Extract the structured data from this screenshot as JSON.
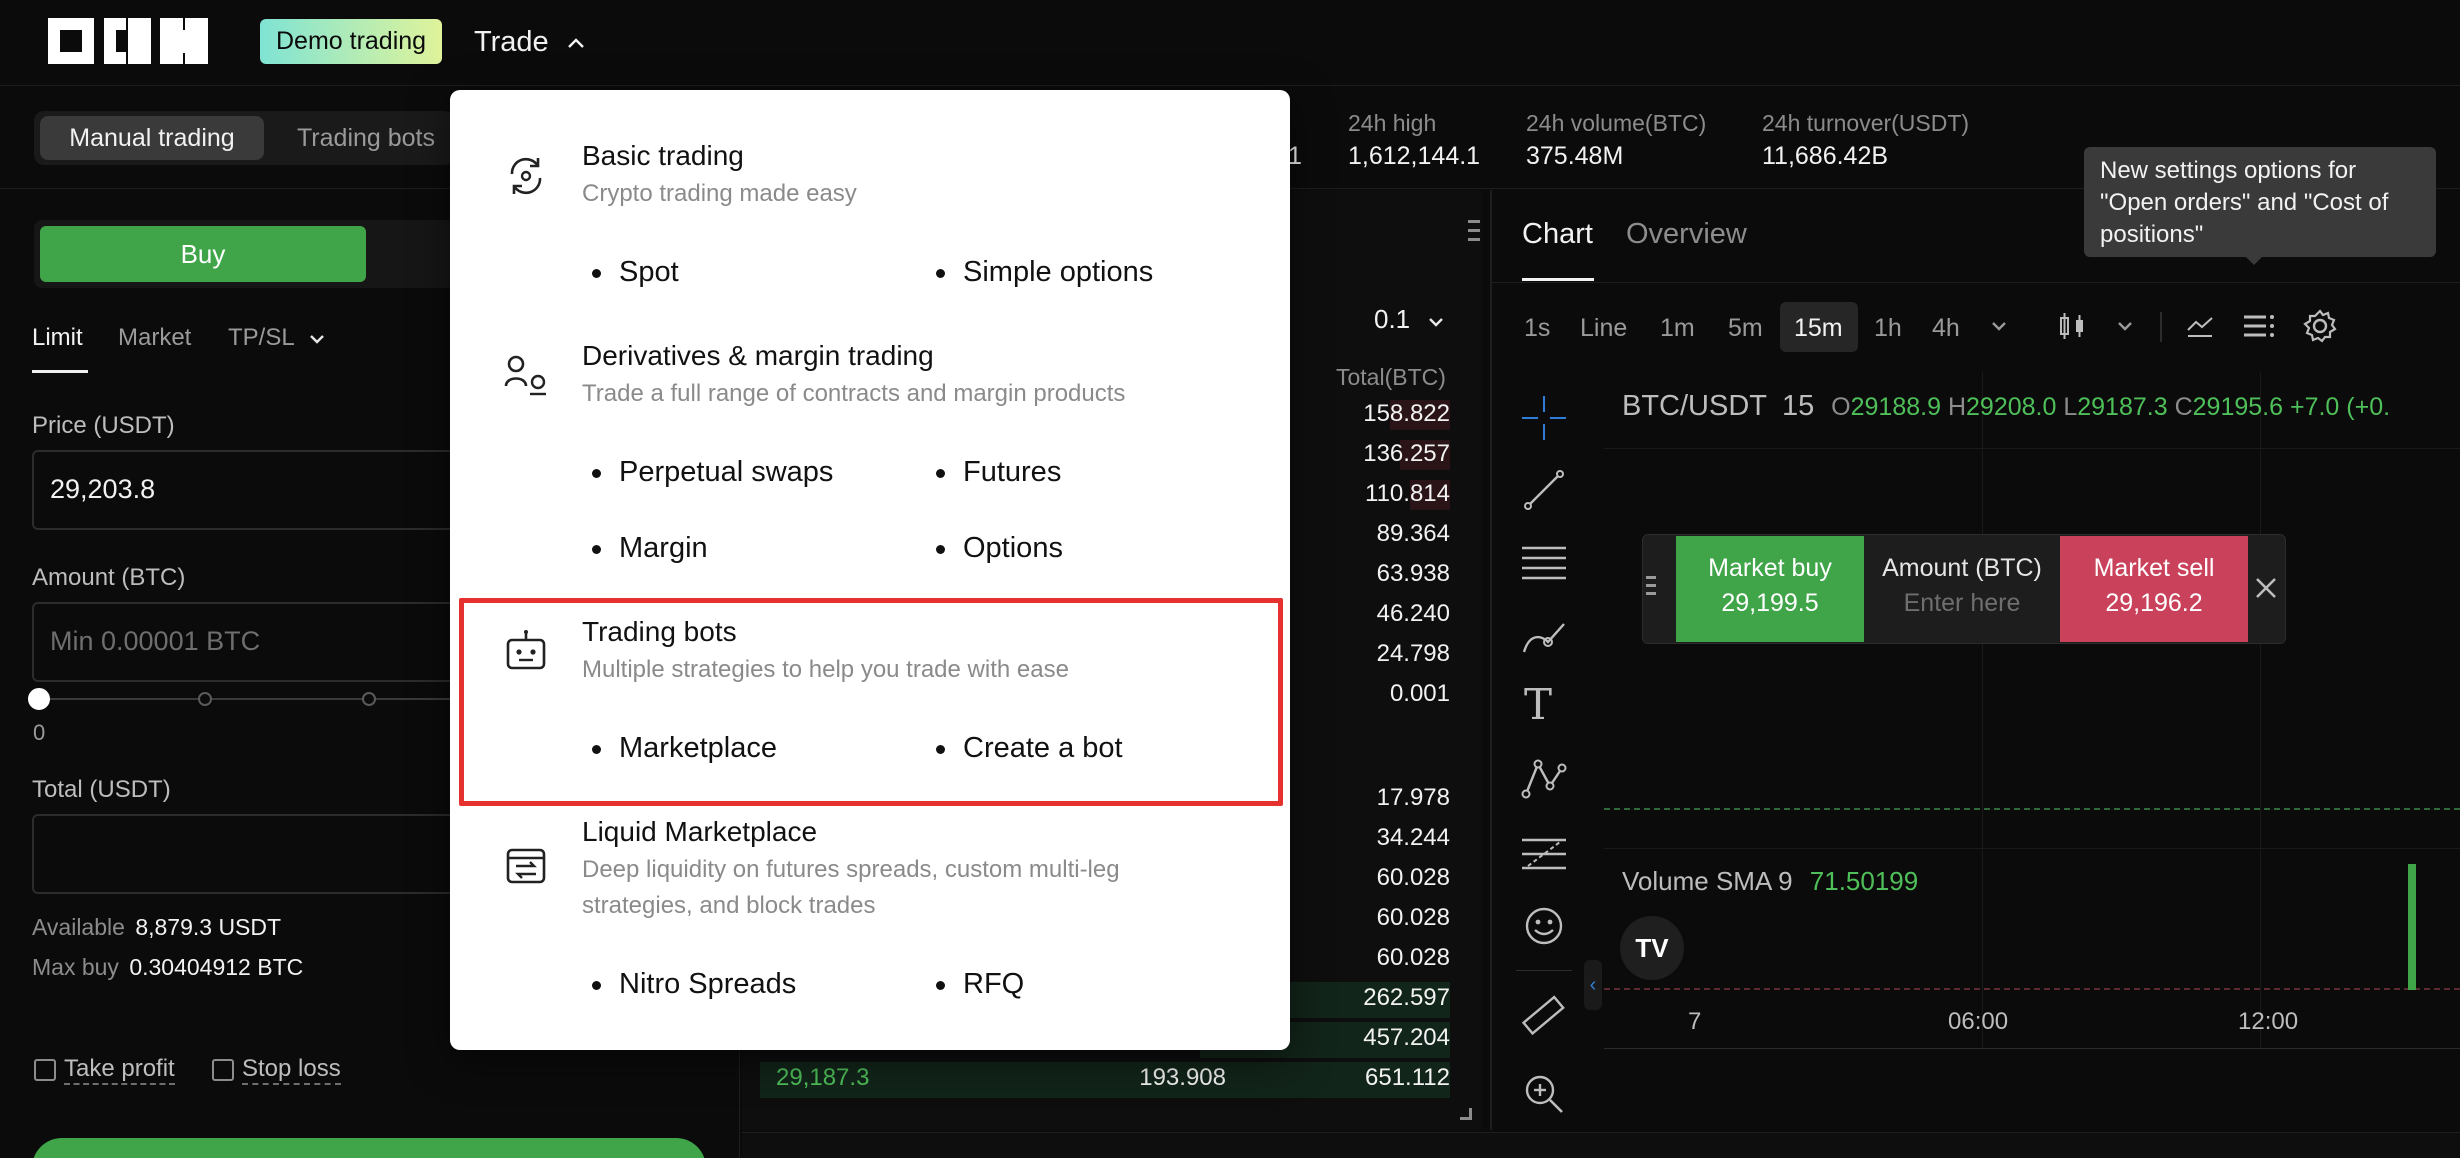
{
  "header": {
    "demo_badge": "Demo trading",
    "trade_menu": "Trade"
  },
  "subbar": {
    "tabs": [
      "Manual trading",
      "Trading bots"
    ],
    "stats_partial_value": "1",
    "stats": [
      {
        "label": "24h high",
        "value": "1,612,144.1"
      },
      {
        "label": "24h volume(BTC)",
        "value": "375.48M"
      },
      {
        "label": "24h turnover(USDT)",
        "value": "11,686.42B"
      }
    ]
  },
  "order_panel": {
    "buy_label": "Buy",
    "order_types": [
      "Limit",
      "Market",
      "TP/SL"
    ],
    "price_label": "Price (USDT)",
    "price_value": "29,203.8",
    "amount_label": "Amount (BTC)",
    "amount_placeholder": "Min 0.00001 BTC",
    "slider_value_label": "0",
    "slider_level": 0,
    "total_label": "Total (USDT)",
    "available_label": "Available",
    "available_value": "8,879.3 USDT",
    "max_buy_label": "Max buy",
    "max_buy_value": "0.30404912 BTC",
    "take_profit": "Take profit",
    "stop_loss": "Stop loss"
  },
  "order_book": {
    "precision": "0.1",
    "total_header": "Total(BTC)",
    "totals_top": [
      "158.822",
      "136.257",
      "110.814",
      "89.364",
      "63.938",
      "46.240",
      "24.798",
      "0.001"
    ],
    "totals_bottom": [
      "17.978",
      "34.244",
      "60.028",
      "60.028",
      "60.028",
      "262.597",
      "457.204"
    ],
    "last_row": {
      "price": "29,187.3",
      "amount": "193.908",
      "total": "651.112"
    }
  },
  "chart": {
    "tabs": [
      "Chart",
      "Overview"
    ],
    "timeframes": [
      "1s",
      "Line",
      "1m",
      "5m",
      "15m",
      "1h",
      "4h"
    ],
    "active_timeframe": "15m",
    "symbol": "BTC/USDT",
    "interval": "15",
    "ohlc": {
      "o_label": "O",
      "o": "29188.9",
      "h_label": "H",
      "h": "29208.0",
      "l_label": "L",
      "l": "29187.3",
      "c_label": "C",
      "c": "29195.6",
      "change": "+7.0 (+0."
    },
    "volume_label": "Volume SMA 9",
    "volume_value": "71.50199",
    "x_ticks": [
      "7",
      "06:00",
      "12:00"
    ],
    "tooltip": "New settings options for \"Open orders\" and \"Cost of positions\"",
    "trade_widget": {
      "buy_label": "Market buy",
      "buy_price": "29,199.5",
      "amount_label": "Amount (BTC)",
      "amount_placeholder": "Enter here",
      "sell_label": "Market sell",
      "sell_price": "29,196.2"
    }
  },
  "dropdown": {
    "sections": [
      {
        "title": "Basic trading",
        "desc": "Crypto trading made easy",
        "items": [
          "Spot",
          "Simple options"
        ]
      },
      {
        "title": "Derivatives & margin trading",
        "desc": "Trade a full range of contracts and margin products",
        "items": [
          "Perpetual swaps",
          "Futures",
          "Margin",
          "Options"
        ]
      },
      {
        "title": "Trading bots",
        "desc": "Multiple strategies to help you trade with ease",
        "items": [
          "Marketplace",
          "Create a bot"
        ]
      },
      {
        "title": "Liquid Marketplace",
        "desc_line1": "Deep liquidity on futures spreads, custom multi-leg",
        "desc_line2": "strategies, and block trades",
        "items": [
          "Nitro Spreads",
          "RFQ"
        ]
      }
    ]
  },
  "colors": {
    "green": "#4fbf59",
    "buy_button": "#3fa548",
    "sell": "#d9485f",
    "highlight": "#e5322f"
  }
}
